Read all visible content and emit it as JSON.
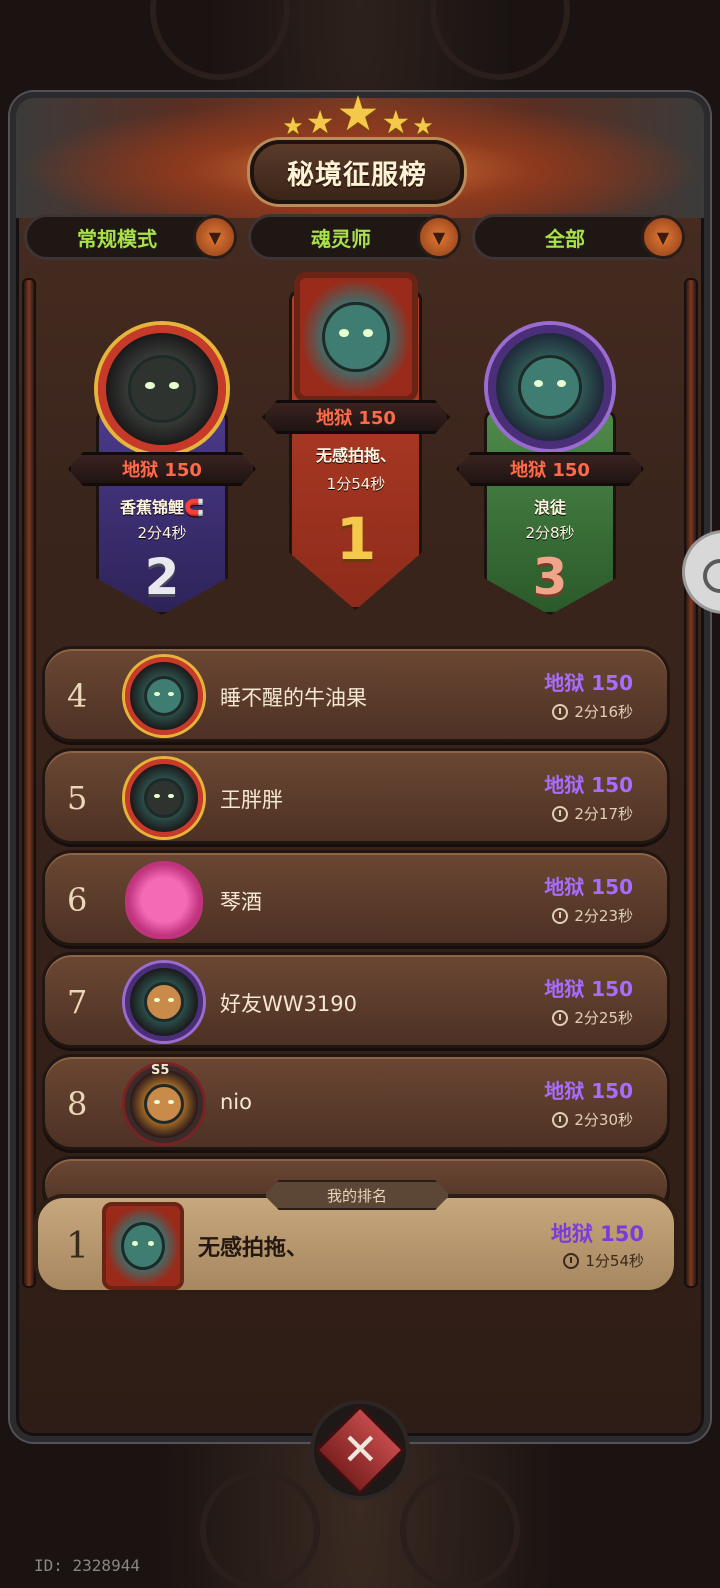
{
  "header": {
    "title": "秘境征服榜"
  },
  "filters": [
    {
      "label": "常规模式"
    },
    {
      "label": "魂灵师"
    },
    {
      "label": "全部"
    }
  ],
  "podium": {
    "first": {
      "rank": "1",
      "level": "地狱 150",
      "name": "无感拍拖、",
      "time": "1分54秒"
    },
    "second": {
      "rank": "2",
      "level": "地狱 150",
      "name": "香蕉锦鲤🧲",
      "time": "2分4秒"
    },
    "third": {
      "rank": "3",
      "level": "地狱 150",
      "name": "浪徒",
      "time": "2分8秒"
    }
  },
  "list": [
    {
      "rank": "4",
      "name": "睡不醒的牛油果",
      "level": "地狱 150",
      "time": "2分16秒"
    },
    {
      "rank": "5",
      "name": "王胖胖",
      "level": "地狱 150",
      "time": "2分17秒"
    },
    {
      "rank": "6",
      "name": "琴酒",
      "level": "地狱 150",
      "time": "2分23秒"
    },
    {
      "rank": "7",
      "name": "好友WW3190",
      "level": "地狱 150",
      "time": "2分25秒"
    },
    {
      "rank": "8",
      "name": "nio",
      "level": "地狱 150",
      "time": "2分30秒",
      "badge": "S5"
    }
  ],
  "my_rank": {
    "tag": "我的排名",
    "rank": "1",
    "name": "无感拍拖、",
    "level": "地狱 150",
    "time": "1分54秒"
  },
  "footer": {
    "user_id": "ID: 2328944"
  },
  "colors": {
    "filter_text": "#a8e14a",
    "level_text": "#a96cff",
    "podium_level_text": "#ff6a4a"
  }
}
